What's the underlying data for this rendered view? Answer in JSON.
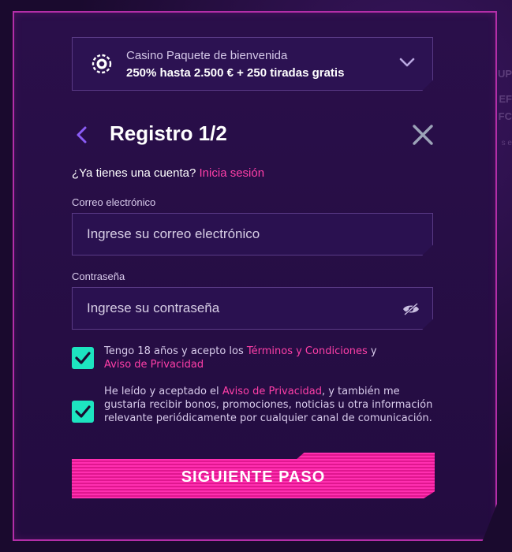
{
  "background": {
    "ghost_texts": [
      "UP",
      "EF",
      "FC",
      "s e"
    ]
  },
  "promo": {
    "line1": "Casino Paquete de bienvenida",
    "line2": "250% hasta 2.500 € + 250 tiradas gratis",
    "icon": "casino-chip-icon"
  },
  "header": {
    "title": "Registro 1/2",
    "back_icon": "chevron-left-icon",
    "close_icon": "close-icon"
  },
  "account": {
    "question": "¿Ya tienes una cuenta?",
    "login_link": "Inicia sesión"
  },
  "form": {
    "email_label": "Correo electrónico",
    "email_placeholder": "Ingrese su correo electrónico",
    "email_value": "",
    "password_label": "Contraseña",
    "password_placeholder": "Ingrese su contraseña",
    "password_value": "",
    "eye_icon": "eye-hidden-icon"
  },
  "consents": [
    {
      "checked": true,
      "text1": "Tengo 18 años y acepto los ",
      "link1": "Términos y Condiciones",
      "text2": " y ",
      "link2": "Aviso de Privacidad",
      "text3": ""
    },
    {
      "checked": true,
      "text1": "He leído y aceptado el ",
      "link1": "Aviso de Privacidad",
      "text2": ", y también me gustaría recibir bonos, promociones, noticias u otra información relevante periódicamente por cualquier canal de comunicación.",
      "link2": "",
      "text3": ""
    }
  ],
  "cta": {
    "label": "SIGUIENTE PASO"
  },
  "colors": {
    "accent_pink": "#ff3fa8",
    "check_teal": "#1de4c0",
    "modal_bg": "#2a0f4a",
    "border_glow": "#b42ea8"
  }
}
